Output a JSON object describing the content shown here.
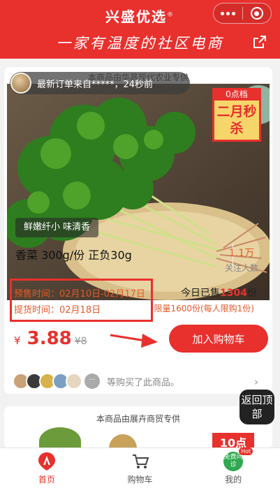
{
  "header": {
    "app_title": "兴盛优选",
    "registered": "®",
    "slogan": "一家有温度的社区电商"
  },
  "product": {
    "supplier": "本商品由华昌现代农业专供",
    "order_ticker": "最新订单来自*****，24秒前",
    "image_tag": "鲜嫩纤小 味清香",
    "badge_top": "0点档",
    "badge_main": "二月秒杀",
    "name": "香菜 300g/份 正负30g",
    "followers_count": "1.1万",
    "followers_label": "关注人数",
    "presale_label": "预售时间：",
    "presale_value": "02月10日-02月17日",
    "pickup_label": "提货时间：",
    "pickup_value": "02月18日",
    "sold_prefix": "今日已售",
    "sold_count": "1304",
    "sold_suffix": "份",
    "limit_text": "限量1600份(每人限购1份)",
    "currency": "¥",
    "price": "3.88",
    "original_price": "¥8",
    "add_to_cart": "加入购物车",
    "buyers_text": "等购买了此商品。",
    "buyers_more": "···"
  },
  "product2": {
    "supplier": "本商品由展卉商贸专供",
    "flash_tag": "10点"
  },
  "back_to_top": "返回顶部",
  "tabbar": {
    "home": "首页",
    "cart": "购物车",
    "mine": "我的",
    "free_consult": "免费问诊",
    "hot": "Hot"
  },
  "colors": {
    "brand_red": "#e8302d",
    "accent_orange": "#e35a2a"
  }
}
